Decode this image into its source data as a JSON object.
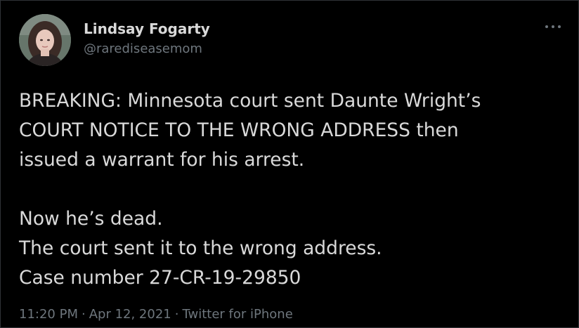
{
  "author": {
    "display_name": "Lindsay Fogarty",
    "handle": "@rarediseasemom",
    "avatar": "profile-photo"
  },
  "menu": {
    "icon": "more-horizontal-icon"
  },
  "tweet": {
    "paragraph_1": [
      "BREAKING: Minnesota court sent Daunte Wright’s",
      "COURT NOTICE TO THE WRONG ADDRESS then",
      "issued a warrant for his arrest."
    ],
    "paragraph_2": [
      "Now he’s dead.",
      "The court sent it to the wrong address.",
      "Case number 27-CR-19-29850"
    ]
  },
  "meta": {
    "time": "11:20 PM",
    "separator": "·",
    "date": "Apr 12, 2021",
    "source": "Twitter for iPhone"
  },
  "colors": {
    "background": "#000000",
    "primary_text": "#d9d9d9",
    "secondary_text": "#6e767d",
    "border": "#2f3336"
  }
}
